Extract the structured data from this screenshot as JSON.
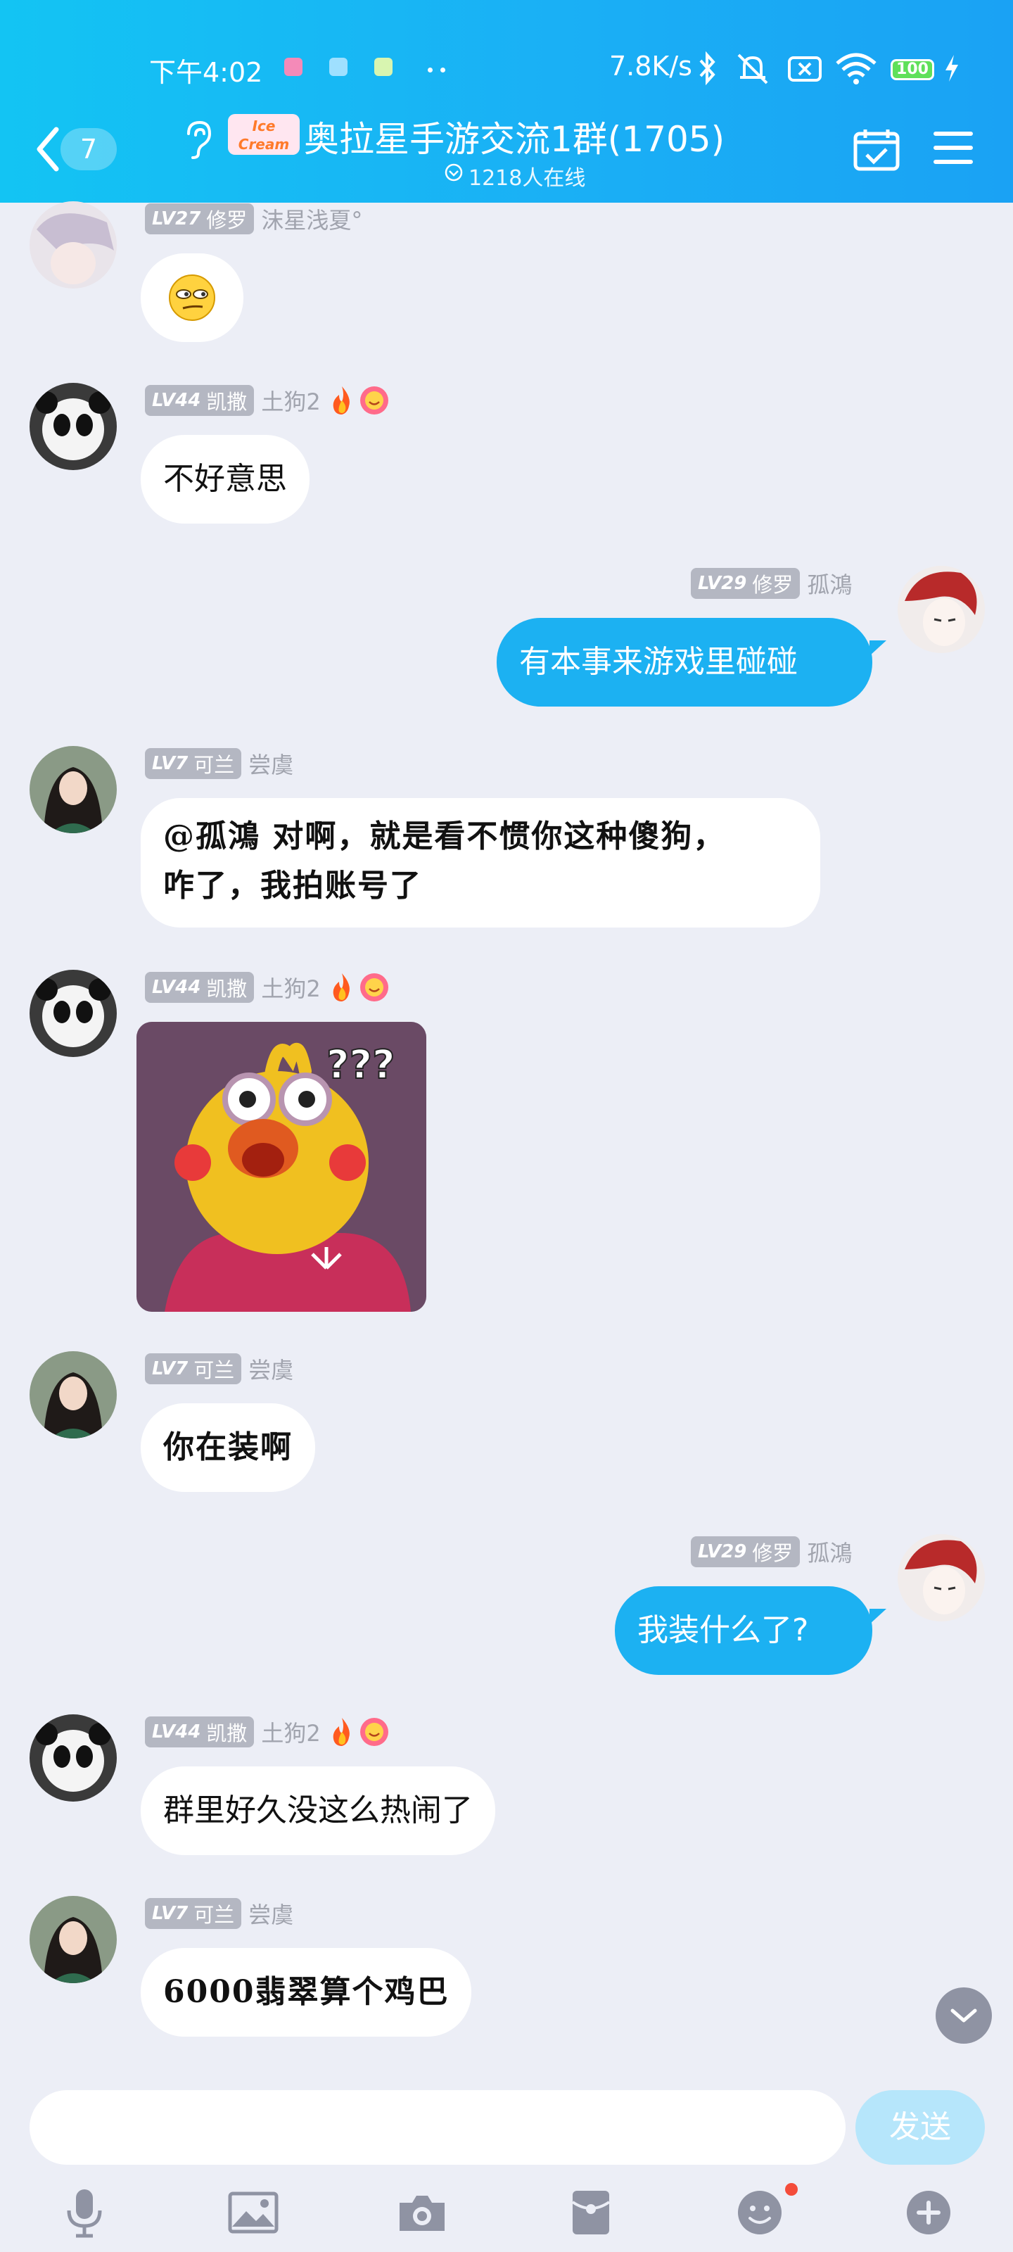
{
  "status_bar": {
    "time": "下午4:02",
    "net_speed": "7.8K/s",
    "battery": "100"
  },
  "header": {
    "unread_count": "7",
    "logo_text_top": "Ice",
    "logo_text_bottom": "Cream",
    "group_title": "奥拉星手游交流1群(1705)",
    "online_text": "1218人在线"
  },
  "messages": [
    {
      "lv": "LV27",
      "title": "修罗",
      "nick": "沫星浅夏°"
    },
    {
      "lv": "LV44",
      "title": "凯撒",
      "nick": "土狗2",
      "text": "不好意思"
    },
    {
      "lv": "LV29",
      "title": "修罗",
      "nick": "孤鴻",
      "text": "有本事来游戏里碰碰"
    },
    {
      "lv": "LV7",
      "title": "可兰",
      "nick": "尝虞",
      "line1": "@孤鴻 对啊，就是看不惯你这种傻狗，",
      "line2": "咋了，我拍账号了"
    },
    {
      "lv": "LV44",
      "title": "凯撒",
      "nick": "土狗2"
    },
    {
      "lv": "LV7",
      "title": "可兰",
      "nick": "尝虞",
      "text": "你在装啊"
    },
    {
      "lv": "LV29",
      "title": "修罗",
      "nick": "孤鴻",
      "text": "我装什么了?"
    },
    {
      "lv": "LV44",
      "title": "凯撒",
      "nick": "土狗2",
      "text": "群里好久没这么热闹了"
    },
    {
      "lv": "LV7",
      "title": "可兰",
      "nick": "尝虞",
      "text": "6000翡翠算个鸡巴"
    }
  ],
  "input": {
    "placeholder": "",
    "send_label": "发送"
  },
  "toolbar": {
    "items": [
      "microphone-icon",
      "image-icon",
      "camera-icon",
      "red-packet-icon",
      "emoji-icon",
      "plus-icon"
    ]
  },
  "colors": {
    "header_start": "#13c4f3",
    "header_end": "#1aa2f4",
    "outgoing_bubble": "#1cb1f2",
    "incoming_bubble": "#ffffff",
    "background": "#eceef6",
    "send_button": "#b6e6fb",
    "level_badge": "#b4b7c2"
  }
}
